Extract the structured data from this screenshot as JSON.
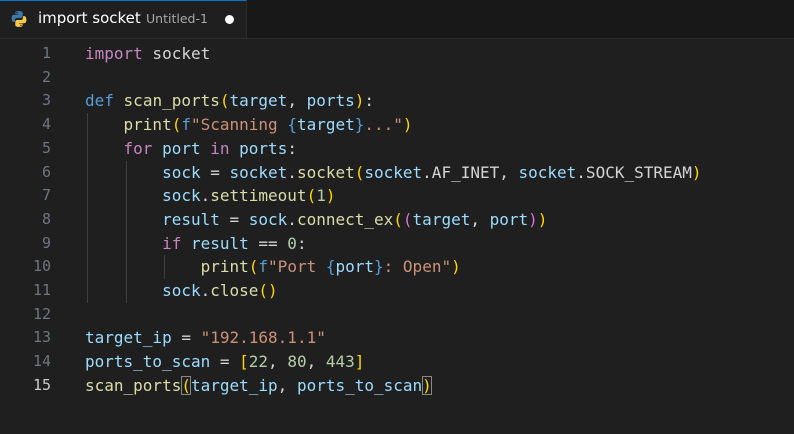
{
  "tab": {
    "icon": "python-icon",
    "title": "import socket",
    "description": "Untitled-1",
    "dirty": true
  },
  "editor": {
    "active_line": 15,
    "lines": [
      {
        "number": "1",
        "tokens": [
          {
            "t": "import",
            "c": "kw"
          },
          {
            "t": " socket",
            "c": "plain"
          }
        ]
      },
      {
        "number": "2",
        "tokens": []
      },
      {
        "number": "3",
        "tokens": [
          {
            "t": "def",
            "c": "def"
          },
          {
            "t": " ",
            "c": "plain"
          },
          {
            "t": "scan_ports",
            "c": "fn"
          },
          {
            "t": "(",
            "c": "b1"
          },
          {
            "t": "target",
            "c": "var"
          },
          {
            "t": ", ",
            "c": "plain"
          },
          {
            "t": "ports",
            "c": "var"
          },
          {
            "t": ")",
            "c": "b1"
          },
          {
            "t": ":",
            "c": "plain"
          }
        ]
      },
      {
        "number": "4",
        "tokens": [
          {
            "t": "    ",
            "c": "plain"
          },
          {
            "t": "print",
            "c": "fn"
          },
          {
            "t": "(",
            "c": "b1"
          },
          {
            "t": "f",
            "c": "def"
          },
          {
            "t": "\"Scanning ",
            "c": "str"
          },
          {
            "t": "{",
            "c": "def"
          },
          {
            "t": "target",
            "c": "var"
          },
          {
            "t": "}",
            "c": "def"
          },
          {
            "t": "...\"",
            "c": "str"
          },
          {
            "t": ")",
            "c": "b1"
          }
        ]
      },
      {
        "number": "5",
        "tokens": [
          {
            "t": "    ",
            "c": "plain"
          },
          {
            "t": "for",
            "c": "kw"
          },
          {
            "t": " ",
            "c": "plain"
          },
          {
            "t": "port",
            "c": "var"
          },
          {
            "t": " ",
            "c": "plain"
          },
          {
            "t": "in",
            "c": "kw"
          },
          {
            "t": " ",
            "c": "plain"
          },
          {
            "t": "ports",
            "c": "var"
          },
          {
            "t": ":",
            "c": "plain"
          }
        ]
      },
      {
        "number": "6",
        "tokens": [
          {
            "t": "        ",
            "c": "plain"
          },
          {
            "t": "sock",
            "c": "var"
          },
          {
            "t": " = ",
            "c": "plain"
          },
          {
            "t": "socket",
            "c": "var"
          },
          {
            "t": ".",
            "c": "plain"
          },
          {
            "t": "socket",
            "c": "fn"
          },
          {
            "t": "(",
            "c": "b1"
          },
          {
            "t": "socket",
            "c": "var"
          },
          {
            "t": ".AF_INET, ",
            "c": "plain"
          },
          {
            "t": "socket",
            "c": "var"
          },
          {
            "t": ".SOCK_STREAM",
            "c": "plain"
          },
          {
            "t": ")",
            "c": "b1"
          }
        ]
      },
      {
        "number": "7",
        "tokens": [
          {
            "t": "        ",
            "c": "plain"
          },
          {
            "t": "sock",
            "c": "var"
          },
          {
            "t": ".",
            "c": "plain"
          },
          {
            "t": "settimeout",
            "c": "fn"
          },
          {
            "t": "(",
            "c": "b1"
          },
          {
            "t": "1",
            "c": "num"
          },
          {
            "t": ")",
            "c": "b1"
          }
        ]
      },
      {
        "number": "8",
        "tokens": [
          {
            "t": "        ",
            "c": "plain"
          },
          {
            "t": "result",
            "c": "var"
          },
          {
            "t": " = ",
            "c": "plain"
          },
          {
            "t": "sock",
            "c": "var"
          },
          {
            "t": ".",
            "c": "plain"
          },
          {
            "t": "connect_ex",
            "c": "fn"
          },
          {
            "t": "(",
            "c": "b1"
          },
          {
            "t": "(",
            "c": "b2"
          },
          {
            "t": "target",
            "c": "var"
          },
          {
            "t": ", ",
            "c": "plain"
          },
          {
            "t": "port",
            "c": "var"
          },
          {
            "t": ")",
            "c": "b2"
          },
          {
            "t": ")",
            "c": "b1"
          }
        ]
      },
      {
        "number": "9",
        "tokens": [
          {
            "t": "        ",
            "c": "plain"
          },
          {
            "t": "if",
            "c": "kw"
          },
          {
            "t": " ",
            "c": "plain"
          },
          {
            "t": "result",
            "c": "var"
          },
          {
            "t": " == ",
            "c": "plain"
          },
          {
            "t": "0",
            "c": "num"
          },
          {
            "t": ":",
            "c": "plain"
          }
        ]
      },
      {
        "number": "10",
        "tokens": [
          {
            "t": "            ",
            "c": "plain"
          },
          {
            "t": "print",
            "c": "fn"
          },
          {
            "t": "(",
            "c": "b1"
          },
          {
            "t": "f",
            "c": "def"
          },
          {
            "t": "\"Port ",
            "c": "str"
          },
          {
            "t": "{",
            "c": "def"
          },
          {
            "t": "port",
            "c": "var"
          },
          {
            "t": "}",
            "c": "def"
          },
          {
            "t": ": Open\"",
            "c": "str"
          },
          {
            "t": ")",
            "c": "b1"
          }
        ]
      },
      {
        "number": "11",
        "tokens": [
          {
            "t": "        ",
            "c": "plain"
          },
          {
            "t": "sock",
            "c": "var"
          },
          {
            "t": ".",
            "c": "plain"
          },
          {
            "t": "close",
            "c": "fn"
          },
          {
            "t": "()",
            "c": "b1"
          }
        ]
      },
      {
        "number": "12",
        "tokens": []
      },
      {
        "number": "13",
        "tokens": [
          {
            "t": "target_ip",
            "c": "var"
          },
          {
            "t": " = ",
            "c": "plain"
          },
          {
            "t": "\"192.168.1.1\"",
            "c": "str"
          }
        ]
      },
      {
        "number": "14",
        "tokens": [
          {
            "t": "ports_to_scan",
            "c": "var"
          },
          {
            "t": " = ",
            "c": "plain"
          },
          {
            "t": "[",
            "c": "b1"
          },
          {
            "t": "22",
            "c": "num"
          },
          {
            "t": ", ",
            "c": "plain"
          },
          {
            "t": "80",
            "c": "num"
          },
          {
            "t": ", ",
            "c": "plain"
          },
          {
            "t": "443",
            "c": "num"
          },
          {
            "t": "]",
            "c": "b1"
          }
        ]
      },
      {
        "number": "15",
        "tokens": [
          {
            "t": "scan_ports",
            "c": "fn"
          },
          {
            "t": "(",
            "c": "b1 match"
          },
          {
            "t": "target_ip",
            "c": "var"
          },
          {
            "t": ", ",
            "c": "plain"
          },
          {
            "t": "ports_to_scan",
            "c": "var"
          },
          {
            "t": ")",
            "c": "b1 match"
          }
        ]
      }
    ]
  }
}
